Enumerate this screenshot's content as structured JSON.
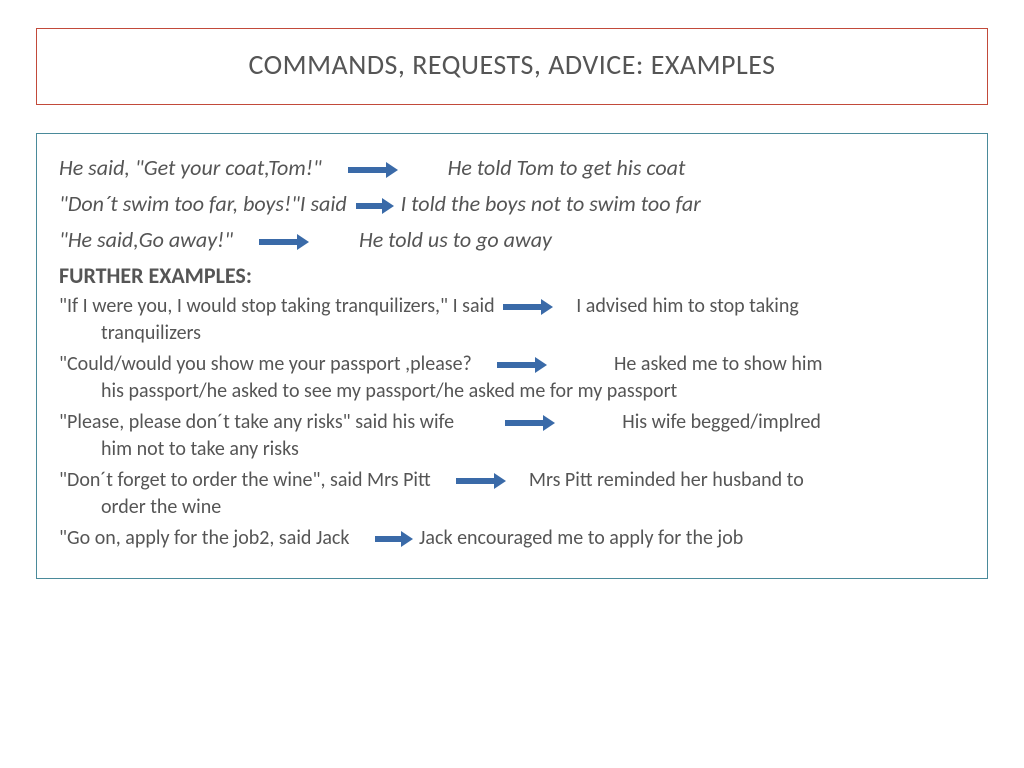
{
  "title": "COMMANDS, REQUESTS, ADVICE: EXAMPLES",
  "intro": [
    {
      "direct": "He said, \"Get your coat,Tom!\"",
      "reported": "He told Tom to get his coat"
    },
    {
      "direct": "\"Don´t swim too far, boys!\"I said",
      "reported": "I told the boys not to swim too far"
    },
    {
      "direct": "\"He said,Go away!\"",
      "reported": "He told us to go away"
    }
  ],
  "further_heading": "FURTHER EXAMPLES:",
  "examples": [
    {
      "direct": "\"If I were you, I would stop taking tranquilizers,\" I said",
      "reported": "I advised him to stop taking",
      "cont": "tranquilizers"
    },
    {
      "direct": "\"Could/would you show me your passport ,please?",
      "reported": "He asked me to show him",
      "cont": "his passport/he asked to see my passport/he asked me for my passport"
    },
    {
      "direct": "\"Please, please don´t take any risks\" said  his wife",
      "reported": "His wife begged/implred",
      "cont": "him not to take any risks"
    },
    {
      "direct": "\"Don´t forget to order the wine\", said Mrs Pitt",
      "reported": "Mrs Pitt reminded her husband to",
      "cont": "order the wine"
    },
    {
      "direct": "\"Go on, apply for the job2, said Jack",
      "reported": "Jack encouraged me to apply for the job",
      "cont": ""
    }
  ]
}
